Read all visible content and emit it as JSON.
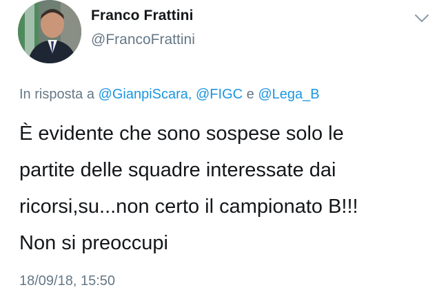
{
  "tweet": {
    "author": {
      "display_name": "Franco Frattini",
      "handle": "@FrancoFrattini"
    },
    "reply": {
      "prefix": "In risposta a",
      "mention_1": "@GianpiScara,",
      "mention_2": "@FIGC",
      "conjunction": "e",
      "mention_3": "@Lega_B"
    },
    "text_lines": [
      "È evidente che sono sospese solo le",
      "partite delle squadre interessate dai",
      "ricorsi,su...non certo il campionato B!!!",
      "Non si preoccupi"
    ],
    "timestamp": "18/09/18, 15:50"
  },
  "icons": {
    "avatar": "profile-photo",
    "menu": "chevron-down-icon"
  },
  "colors": {
    "text": "#14171a",
    "secondary": "#657786",
    "link": "#1b95e0",
    "background": "#ffffff"
  }
}
